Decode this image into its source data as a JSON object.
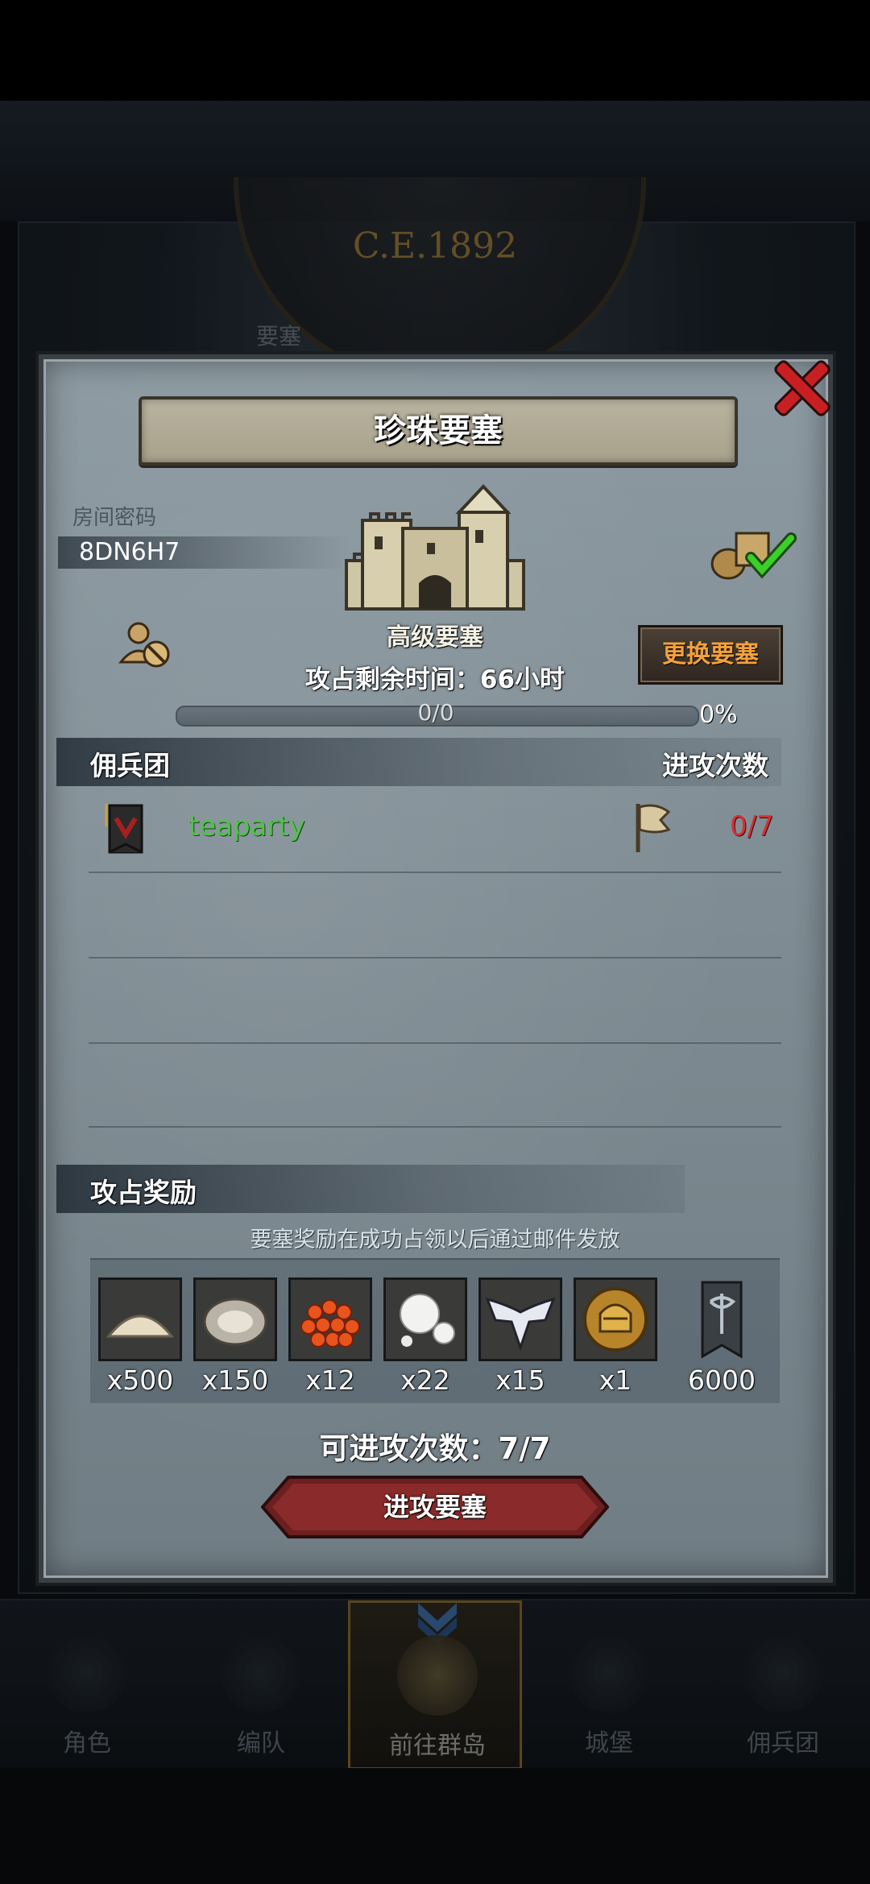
{
  "background": {
    "year": "C.E.1892",
    "dim_label": "要塞"
  },
  "nav": {
    "items": [
      {
        "label": "角色",
        "icon": "knight-icon"
      },
      {
        "label": "编队",
        "icon": "helmet-icon"
      },
      {
        "label": "前往群岛",
        "icon": "compass-icon",
        "active": true
      },
      {
        "label": "城堡",
        "icon": "castle-icon"
      },
      {
        "label": "佣兵团",
        "icon": "mercenary-icon"
      }
    ]
  },
  "dialog": {
    "title": "珍珠要塞",
    "room_label": "房间密码",
    "room_code": "8DN6H7",
    "fortress_level": "高级要塞",
    "change_button": "更换要塞",
    "time_remaining": "攻占剩余时间：66小时",
    "progress": {
      "count": "0/0",
      "percent": "0%",
      "fraction": 0
    },
    "mercenary_header": "佣兵团",
    "attack_count_header": "进攻次数",
    "mercenaries": [
      {
        "name": "teaparty",
        "attacks": "0/7"
      }
    ],
    "rewards_header": "攻占奖励",
    "rewards_note": "要塞奖励在成功占领以后通过邮件发放",
    "rewards": [
      {
        "icon": "sand-icon",
        "qty": "x500"
      },
      {
        "icon": "oyster-icon",
        "qty": "x150"
      },
      {
        "icon": "roe-icon",
        "qty": "x12"
      },
      {
        "icon": "pearl-icon",
        "qty": "x22"
      },
      {
        "icon": "winged-crest-icon",
        "qty": "x15"
      },
      {
        "icon": "golden-helmet-coin-icon",
        "qty": "x1"
      },
      {
        "icon": "banner-icon",
        "qty": "6000"
      }
    ],
    "remaining_attacks": "可进攻次数：7/7",
    "attack_button": "进攻要塞"
  },
  "colors": {
    "accent_orange": "#f2a13a",
    "merc_green": "#4fc34c",
    "attack_red": "#d63030",
    "close_red": "#c81f22"
  }
}
